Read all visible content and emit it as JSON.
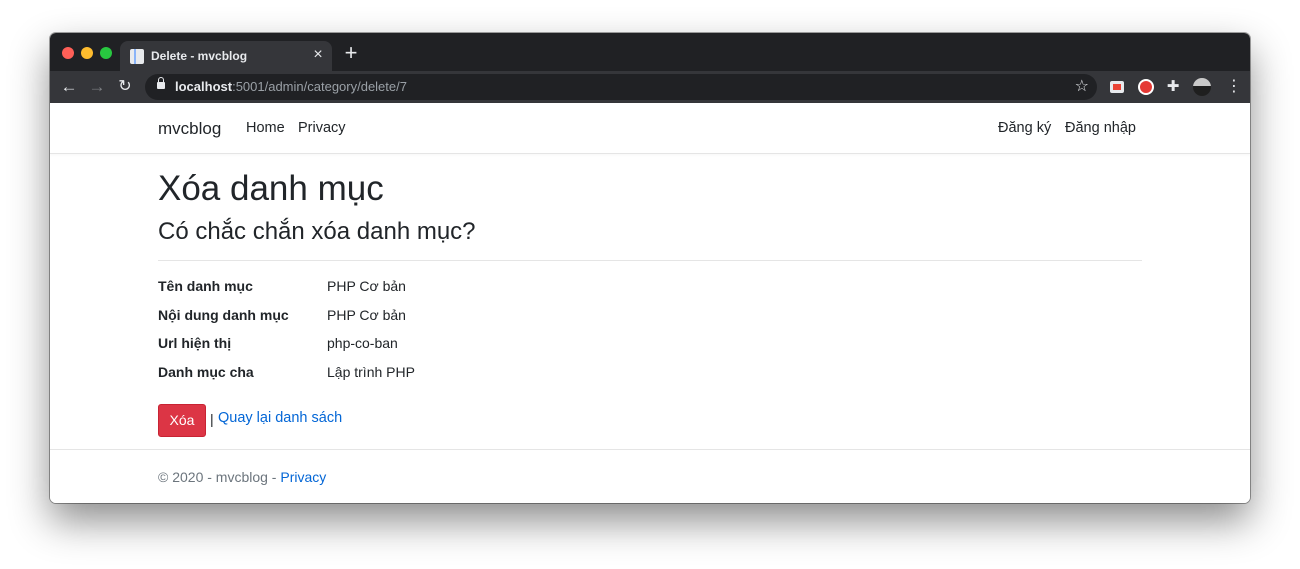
{
  "browser": {
    "tab": {
      "title": "Delete - mvcblog",
      "close": "×"
    },
    "new_tab": "+",
    "nav": {
      "back": "←",
      "forward": "→",
      "reload": "↻"
    },
    "url": {
      "host": "localhost",
      "rest": ":5001/admin/category/delete/7"
    },
    "star": "☆",
    "menu": "⋮",
    "puzzle": "✚"
  },
  "navbar": {
    "brand": "mvcblog",
    "links": [
      "Home",
      "Privacy"
    ],
    "right_links": [
      "Đăng ký",
      "Đăng nhập"
    ]
  },
  "main": {
    "title": "Xóa danh mục",
    "subtitle": "Có chắc chắn xóa danh mục?",
    "details": [
      {
        "label": "Tên danh mục",
        "value": "PHP Cơ bản"
      },
      {
        "label": "Nội dung danh mục",
        "value": "PHP Cơ bản"
      },
      {
        "label": "Url hiện thị",
        "value": "php-co-ban"
      },
      {
        "label": "Danh mục cha",
        "value": "Lập trình PHP"
      }
    ],
    "delete_button": "Xóa",
    "separator": "|",
    "back_link": "Quay lại danh sách"
  },
  "footer": {
    "text": "© 2020 - mvcblog - ",
    "link": "Privacy"
  },
  "colors": {
    "danger": "#dc3545",
    "link": "#0366d6",
    "chrome_dark": "#202124",
    "chrome_toolbar": "#35363a"
  }
}
